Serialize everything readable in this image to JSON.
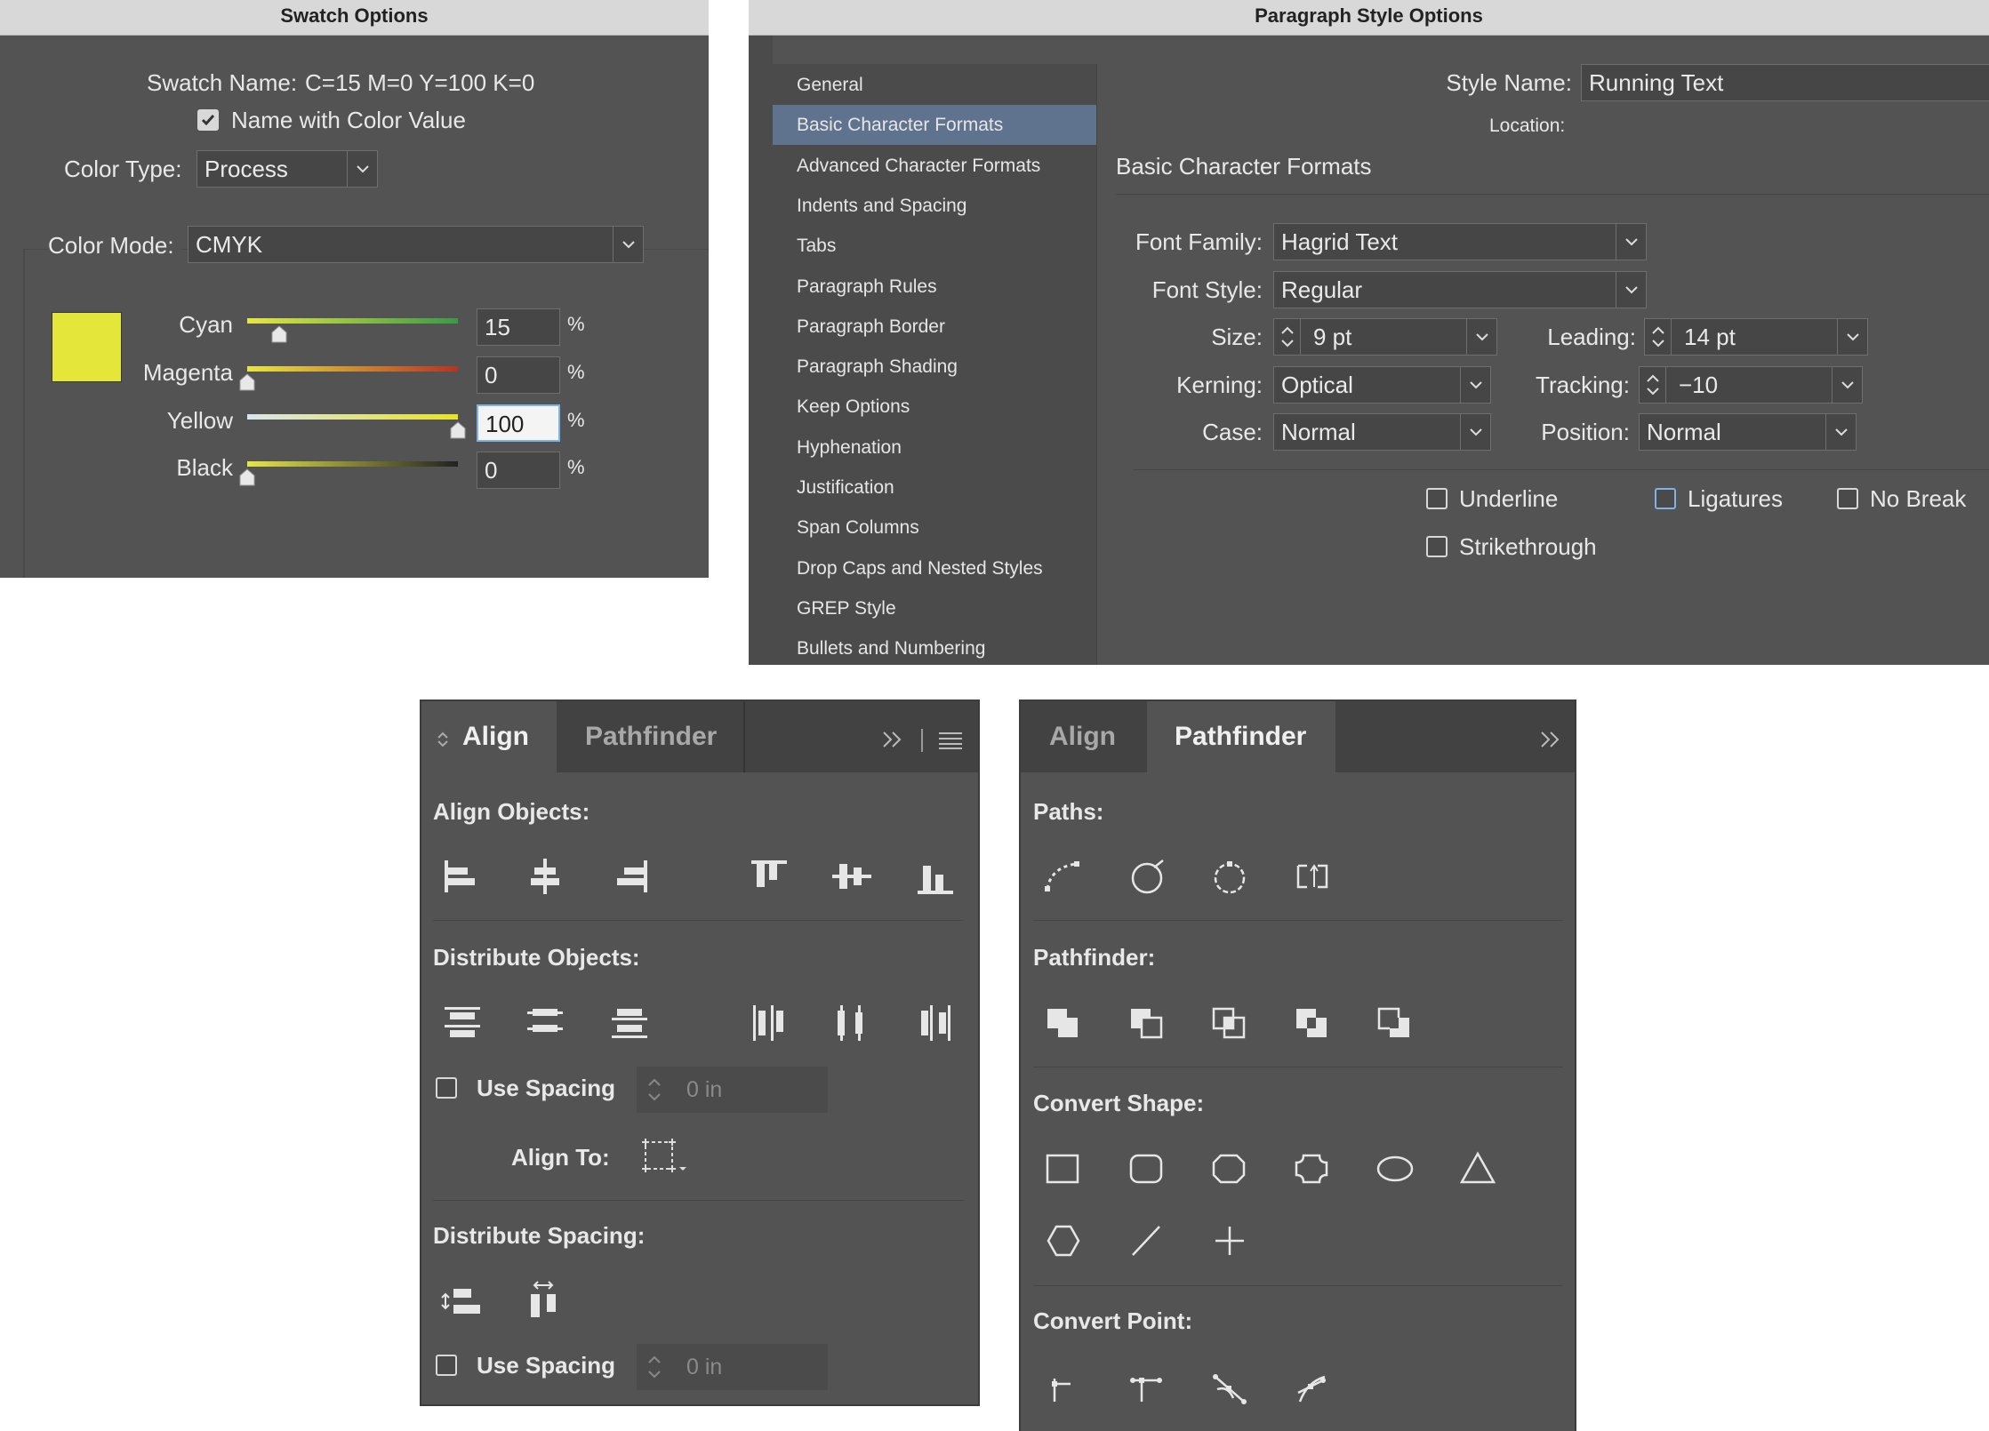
{
  "swatch": {
    "title": "Swatch Options",
    "swatch_name_label": "Swatch Name:",
    "swatch_name_value": "C=15 M=0 Y=100 K=0",
    "name_with_color_value": "Name with Color Value",
    "color_type_label": "Color Type:",
    "color_type_value": "Process",
    "color_mode_label": "Color Mode:",
    "color_mode_value": "CMYK",
    "swatch_color": "#e4e63a",
    "sliders": [
      {
        "label": "Cyan",
        "value": "15",
        "level": 0.15,
        "gradient": [
          "#e6e643",
          "#3a9a46"
        ]
      },
      {
        "label": "Magenta",
        "value": "0",
        "level": 0.0,
        "gradient": [
          "#e6e643",
          "#b43323"
        ]
      },
      {
        "label": "Yellow",
        "value": "100",
        "level": 1.0,
        "gradient": [
          "#d9e6ee",
          "#e6e229"
        ]
      },
      {
        "label": "Black",
        "value": "0",
        "level": 0.0,
        "gradient": [
          "#e6e643",
          "#222222"
        ]
      }
    ],
    "percent": "%"
  },
  "paragraph": {
    "title": "Paragraph Style Options",
    "sidebar": [
      "General",
      "Basic Character Formats",
      "Advanced Character Formats",
      "Indents and Spacing",
      "Tabs",
      "Paragraph Rules",
      "Paragraph Border",
      "Paragraph Shading",
      "Keep Options",
      "Hyphenation",
      "Justification",
      "Span Columns",
      "Drop Caps and Nested Styles",
      "GREP Style",
      "Bullets and Numbering"
    ],
    "selected_index": 1,
    "style_name_label": "Style Name:",
    "style_name_value": "Running Text",
    "location_label": "Location:",
    "section_title": "Basic Character Formats",
    "font_family_label": "Font Family:",
    "font_family_value": "Hagrid Text",
    "font_style_label": "Font Style:",
    "font_style_value": "Regular",
    "size_label": "Size:",
    "size_value": "9 pt",
    "leading_label": "Leading:",
    "leading_value": "14 pt",
    "kerning_label": "Kerning:",
    "kerning_value": "Optical",
    "tracking_label": "Tracking:",
    "tracking_value": "−10",
    "case_label": "Case:",
    "case_value": "Normal",
    "position_label": "Position:",
    "position_value": "Normal",
    "underline": "Underline",
    "ligatures": "Ligatures",
    "no_break": "No Break",
    "strikethrough": "Strikethrough"
  },
  "align_panel": {
    "tab_align": "Align",
    "tab_pathfinder": "Pathfinder",
    "align_objects": "Align Objects:",
    "distribute_objects": "Distribute Objects:",
    "use_spacing": "Use Spacing",
    "spacing_value": "0 in",
    "align_to": "Align To:",
    "distribute_spacing": "Distribute Spacing:",
    "use_spacing_2": "Use Spacing",
    "spacing_value_2": "0 in"
  },
  "pathfinder_panel": {
    "tab_align": "Align",
    "tab_pathfinder": "Pathfinder",
    "paths": "Paths:",
    "pathfinder": "Pathfinder:",
    "convert_shape": "Convert Shape:",
    "convert_point": "Convert Point:"
  }
}
